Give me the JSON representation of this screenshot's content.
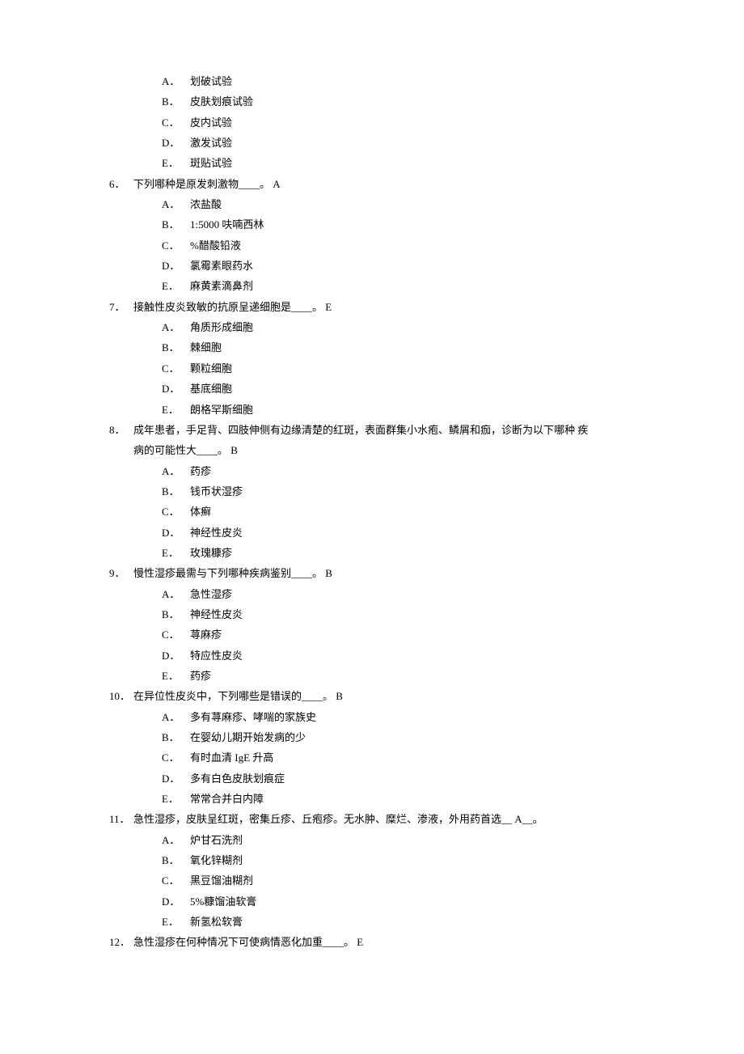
{
  "leadOptions": [
    {
      "label": "A．",
      "text": "划破试验"
    },
    {
      "label": "B．",
      "text": "皮肤划痕试验"
    },
    {
      "label": "C．",
      "text": "皮内试验"
    },
    {
      "label": "D．",
      "text": "激发试验"
    },
    {
      "label": "E．",
      "text": "斑贴试验"
    }
  ],
  "questions": [
    {
      "num": "6．",
      "stem": "下列哪种是原发刺激物____。 A",
      "options": [
        {
          "label": "A．",
          "text": "浓盐酸"
        },
        {
          "label": "B．",
          "text": "1:5000 呋喃西林"
        },
        {
          "label": "C．",
          "text": "%醋酸铅液"
        },
        {
          "label": "D．",
          "text": "氯霉素眼药水"
        },
        {
          "label": "E．",
          "text": "麻黄素滴鼻剂"
        }
      ]
    },
    {
      "num": "7．",
      "stem": "接触性皮炎致敏的抗原呈递细胞是____。 E",
      "options": [
        {
          "label": "A．",
          "text": "角质形成细胞"
        },
        {
          "label": "B．",
          "text": "棘细胞"
        },
        {
          "label": "C．",
          "text": "颗粒细胞"
        },
        {
          "label": "D．",
          "text": "基底细胞"
        },
        {
          "label": "E．",
          "text": "朗格罕斯细胞"
        }
      ]
    },
    {
      "num": "8．",
      "stem": "成年患者，手足背、四肢伸侧有边缘清楚的红斑，表面群集小水疱、鳞屑和痂，诊断为以下哪种 疾",
      "stemCont": "病的可能性大____。 B",
      "options": [
        {
          "label": "A．",
          "text": "药疹"
        },
        {
          "label": "B．",
          "text": "钱币状湿疹"
        },
        {
          "label": "C．",
          "text": "体癣"
        },
        {
          "label": "D．",
          "text": "神经性皮炎"
        },
        {
          "label": "E．",
          "text": "玫瑰糠疹"
        }
      ]
    },
    {
      "num": "9．",
      "stem": "慢性湿疹最需与下列哪种疾病鉴别____。 B",
      "options": [
        {
          "label": "A．",
          "text": "急性湿疹"
        },
        {
          "label": "B．",
          "text": "神经性皮炎"
        },
        {
          "label": "C．",
          "text": "荨麻疹"
        },
        {
          "label": "D．",
          "text": "特应性皮炎"
        },
        {
          "label": "E．",
          "text": "药疹"
        }
      ]
    },
    {
      "num": "10．",
      "stem": "在异位性皮炎中，下列哪些是错误的____。 B",
      "options": [
        {
          "label": "A．",
          "text": "多有荨麻疹、哮喘的家族史"
        },
        {
          "label": "B．",
          "text": "在婴幼儿期开始发病的少"
        },
        {
          "label": "C．",
          "text": "有时血清 IgE 升高"
        },
        {
          "label": "D．",
          "text": "多有白色皮肤划痕症"
        },
        {
          "label": "E．",
          "text": "常常合并白内障"
        }
      ]
    },
    {
      "num": "11．",
      "stem": "急性湿疹，皮肤呈红斑，密集丘疹、丘疱疹。无水肿、糜烂、渗液，外用药首选__ A__。",
      "options": [
        {
          "label": "A．",
          "text": "炉甘石洗剂"
        },
        {
          "label": "B．",
          "text": "氧化锌糊剂"
        },
        {
          "label": "C．",
          "text": "黑豆馏油糊剂"
        },
        {
          "label": "D．",
          "text": "5%糠馏油软膏"
        },
        {
          "label": "E．",
          "text": "新氢松软膏"
        }
      ]
    },
    {
      "num": "12．",
      "stem": "急性湿疹在何种情况下可使病情恶化加重____。 E",
      "options": []
    }
  ]
}
